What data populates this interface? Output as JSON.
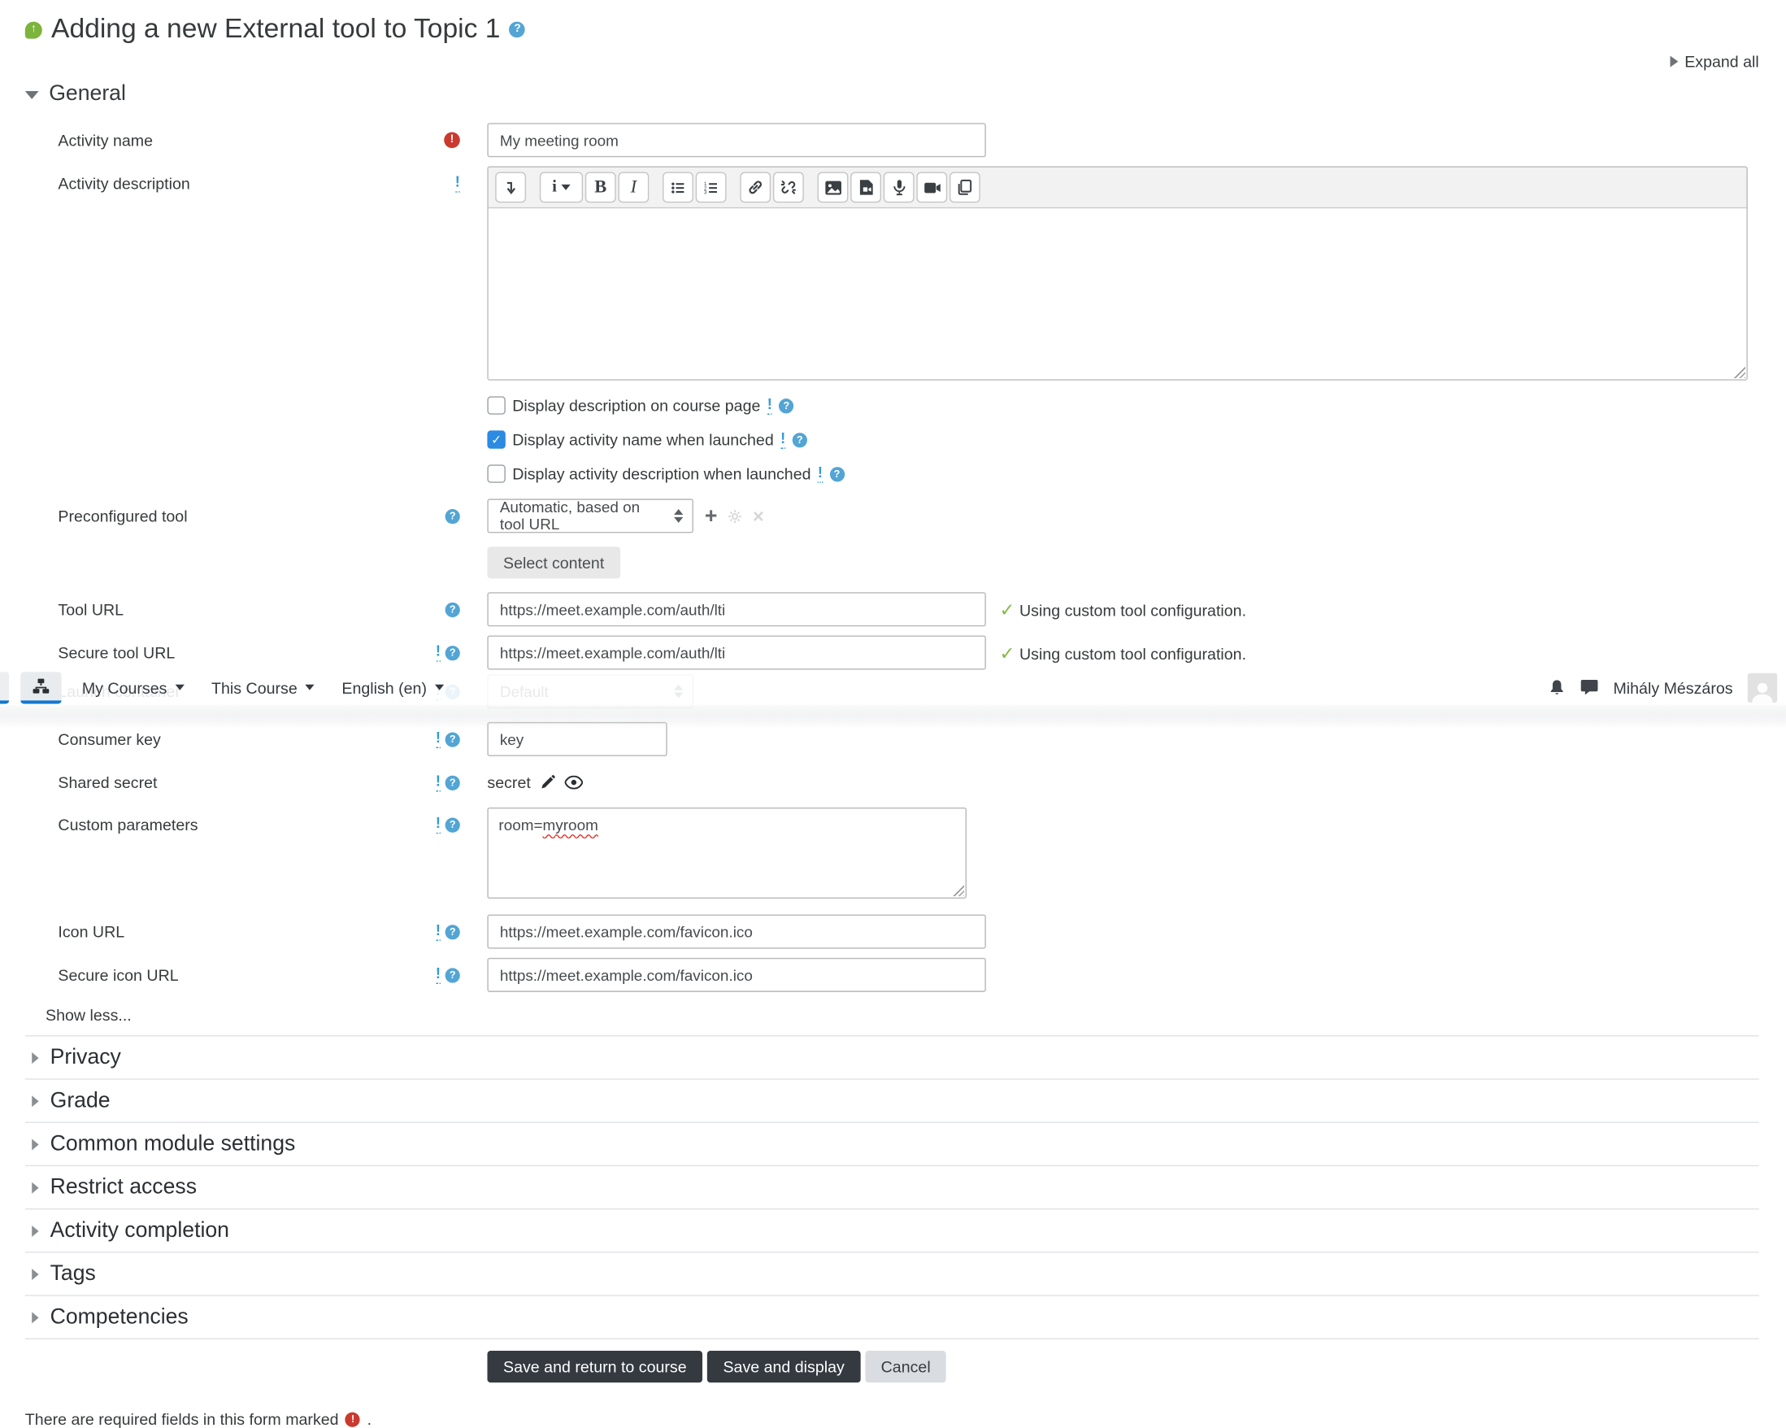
{
  "colors": {
    "accent_blue": "#1177d1",
    "help_blue": "#52a5d4",
    "required_red": "#ca3a2e",
    "check_green": "#84b944",
    "checkbox_blue": "#2b8ae2",
    "button_dark": "#343a40"
  },
  "header": {
    "title": "Adding a new External tool to Topic 1",
    "title_icon": "external-tool-icon",
    "help_icon": "help-question-icon",
    "expand_all": "Expand all"
  },
  "navbar": {
    "icons": [
      "sitemap-icon",
      "notifications-bell-icon",
      "messages-icon",
      "user-avatar"
    ],
    "menus": [
      {
        "label": "My Courses"
      },
      {
        "label": "This Course"
      },
      {
        "label": "English (en)"
      }
    ],
    "user_name": "Mihály Mészáros"
  },
  "general": {
    "heading": "General",
    "activity_name": {
      "label": "Activity name",
      "value": "My meeting room"
    },
    "activity_description": {
      "label": "Activity description",
      "value": ""
    },
    "editor_toolbar_icons": [
      "collapse-toolbar",
      "paragraph-styles",
      "bold",
      "italic",
      "unordered-list",
      "ordered-list",
      "insert-link",
      "unlink",
      "insert-image",
      "insert-media",
      "record-audio",
      "record-video",
      "manage-files"
    ],
    "checkboxes": [
      {
        "label": "Display description on course page",
        "checked": false
      },
      {
        "label": "Display activity name when launched",
        "checked": true
      },
      {
        "label": "Display activity description when launched",
        "checked": false
      }
    ],
    "preconfigured_tool": {
      "label": "Preconfigured tool",
      "value": "Automatic, based on tool URL",
      "select_content_label": "Select content",
      "icon_names": [
        "add-tool-plus-icon",
        "edit-tool-gear-icon",
        "delete-tool-x-icon"
      ]
    },
    "tool_url": {
      "label": "Tool URL",
      "value": "https://meet.example.com/auth/lti",
      "status": "Using custom tool configuration."
    },
    "secure_tool_url": {
      "label": "Secure tool URL",
      "value": "https://meet.example.com/auth/lti",
      "status": "Using custom tool configuration."
    },
    "launch_container": {
      "label": "Launch container",
      "value": "Default"
    },
    "consumer_key": {
      "label": "Consumer key",
      "value": "key"
    },
    "shared_secret": {
      "label": "Shared secret",
      "value": "secret",
      "icon_names": [
        "edit-pencil-icon",
        "reveal-eye-icon"
      ]
    },
    "custom_parameters": {
      "label": "Custom parameters",
      "value": "room=myroom",
      "value_parts": {
        "plain": "room=",
        "spellchecked": "myroom"
      }
    },
    "icon_url": {
      "label": "Icon URL",
      "value": "https://meet.example.com/favicon.ico"
    },
    "secure_icon_url": {
      "label": "Secure icon URL",
      "value": "https://meet.example.com/favicon.ico"
    },
    "show_less": "Show less..."
  },
  "sections": [
    "Privacy",
    "Grade",
    "Common module settings",
    "Restrict access",
    "Activity completion",
    "Tags",
    "Competencies"
  ],
  "actions": {
    "save_return": "Save and return to course",
    "save_display": "Save and display",
    "cancel": "Cancel"
  },
  "required_note": {
    "text": "There are required fields in this form marked",
    "suffix": "."
  }
}
